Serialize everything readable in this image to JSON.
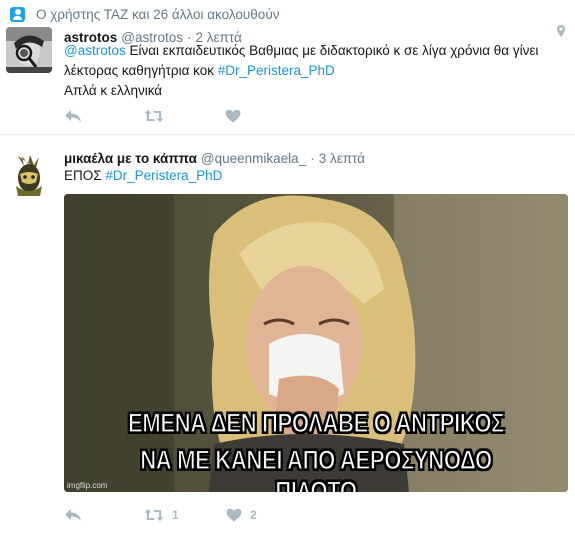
{
  "context": {
    "text": "Ο χρήστης ΤΑΖ και 26 άλλοι ακολουθούν",
    "icon": "user-follow-icon"
  },
  "tweets": [
    {
      "fullname": "astrotos",
      "username": "@astrotos",
      "separator": "·",
      "time": "2 λεπτά",
      "text": {
        "mention": "@astrotos",
        "line1_rest": " Είναι εκπαιδευτικός Βαθμιας με διδακτορικό κ σε λίγα χρόνια θα γίνει",
        "line2": "λέκτορας καθηγήτρια κοκ ",
        "hashtag": "#Dr_Peristera_PhD",
        "line3": "Απλά κ ελληνικά"
      },
      "icons": {
        "geo": "location-pin-icon",
        "reply": "reply-icon",
        "retweet": "retweet-icon",
        "like": "heart-icon"
      }
    },
    {
      "fullname": "μικαέλα με το κάππα",
      "username": "@queenmikaela_",
      "separator": "·",
      "time": "3 λεπτά",
      "text": {
        "prefix": "ΕΠΟΣ ",
        "hashtag": "#Dr_Peristera_PhD"
      },
      "media": {
        "caption_line1": "ΕΜΕΝΑ ΔΕΝ ΠΡΟΛΑΒΕ Ο ΑΝΤΡΙΚΟΣ",
        "caption_line2": "ΝΑ ΜΕ ΚΑΝΕΙ ΑΠΟ ΑΕΡΟΣΥΝΟΔΟ ΠΙΛΟΤΟ",
        "watermark": "imgflip.com"
      },
      "retweet_count": "1",
      "like_count": "2"
    }
  ],
  "colors": {
    "link": "#1b95e0",
    "muted": "#657786",
    "action": "#aab8c2",
    "divider": "#e6ecf0"
  }
}
